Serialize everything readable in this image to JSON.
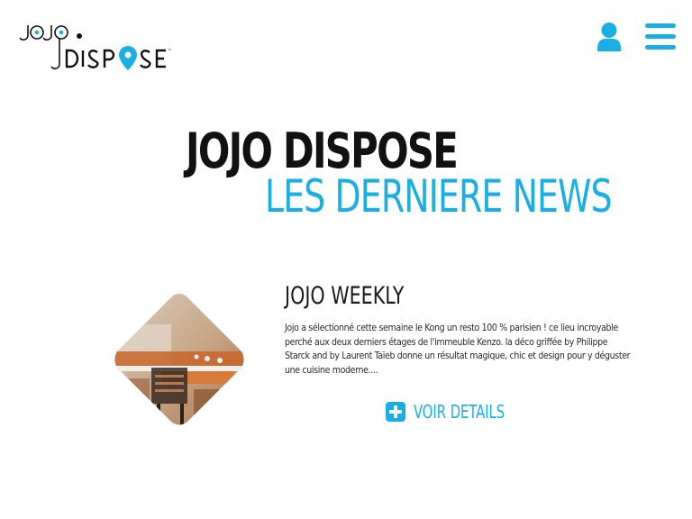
{
  "colors": {
    "accent": "#1aaee6",
    "text": "#111111"
  },
  "header": {
    "logo_text": "JOJO DISPOSE",
    "logo_icon": "map-pin-icon",
    "user_icon": "user-icon",
    "menu_icon": "hamburger-menu-icon"
  },
  "hero": {
    "title": "JOJO DISPOSE",
    "subtitle": "LES DERNIERE NEWS"
  },
  "article": {
    "title": "JOJO WEEKLY",
    "excerpt": "Jojo a sélectionné cette semaine le Kong un resto 100 % parisien ! ce lieu incroyable perché aux deux derniers étages de l'immeuble Kenzo. la déco griffée by Philippe Starck and by Laurent Taïeb donne un résultat magique, chic et design pour y déguster une cuisine moderne....",
    "cta_icon": "plus-icon",
    "cta_label": "VOIR DETAILS"
  }
}
